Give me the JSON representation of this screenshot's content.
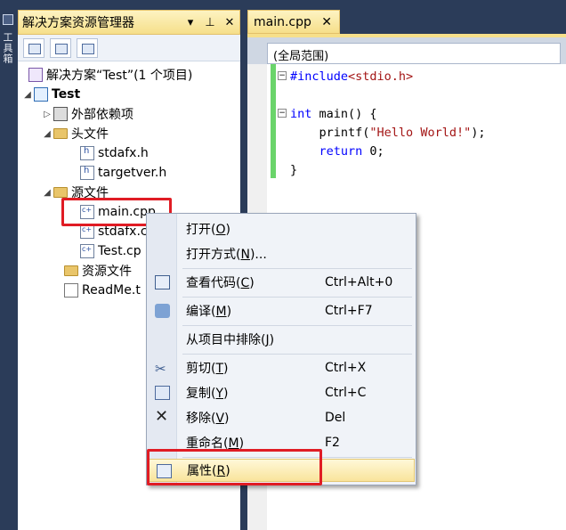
{
  "left_strip": {
    "label": "工具箱"
  },
  "solution_explorer": {
    "title": "解决方案资源管理器",
    "buttons": {
      "dropdown": "▾",
      "pin": "⊥",
      "close": "✕"
    },
    "tree": [
      {
        "text": "解决方案“Test”(1 个项目)",
        "icon": "solution-icon"
      },
      {
        "text": "Test",
        "icon": "project-icon"
      },
      {
        "text": "外部依赖项",
        "icon": "references-icon"
      },
      {
        "text": "头文件",
        "icon": "folder-icon"
      },
      {
        "text": "stdafx.h",
        "icon": "header-file-icon"
      },
      {
        "text": "targetver.h",
        "icon": "header-file-icon"
      },
      {
        "text": "源文件",
        "icon": "folder-icon"
      },
      {
        "text": "main.cpp",
        "icon": "cpp-file-icon"
      },
      {
        "text": "stdafx.c",
        "icon": "cpp-file-icon"
      },
      {
        "text": "Test.cp",
        "icon": "cpp-file-icon"
      },
      {
        "text": "资源文件",
        "icon": "folder-icon"
      },
      {
        "text": "ReadMe.t",
        "icon": "text-file-icon"
      }
    ]
  },
  "editor": {
    "tab_label": "main.cpp",
    "tab_close": "✕",
    "scope_combo": "(全局范围)",
    "code": {
      "include_kw": "#include",
      "include_target": "<stdio.h>",
      "int_kw": "int",
      "main_sig": " main() {",
      "printf_pre": "printf(",
      "printf_str": "\"Hello World!\"",
      "printf_post": ");",
      "return_kw": "return",
      "return_val": " 0;",
      "close_brace": "}"
    }
  },
  "context_menu": {
    "items": [
      {
        "label": "打开",
        "mnemonic": "O",
        "shortcut": ""
      },
      {
        "label": "打开方式",
        "mnemonic": "N",
        "suffix": "...",
        "shortcut": ""
      },
      {
        "label": "查看代码",
        "mnemonic": "C",
        "shortcut": "Ctrl+Alt+0"
      },
      {
        "label": "编译",
        "mnemonic": "M",
        "shortcut": "Ctrl+F7"
      },
      {
        "label": "从项目中排除",
        "mnemonic": "J",
        "shortcut": ""
      },
      {
        "label": "剪切",
        "mnemonic": "T",
        "shortcut": "Ctrl+X"
      },
      {
        "label": "复制",
        "mnemonic": "Y",
        "shortcut": "Ctrl+C"
      },
      {
        "label": "移除",
        "mnemonic": "V",
        "shortcut": "Del"
      },
      {
        "label": "重命名",
        "mnemonic": "M",
        "shortcut": "F2"
      },
      {
        "label": "属性",
        "mnemonic": "R",
        "shortcut": ""
      }
    ]
  },
  "colors": {
    "highlight_box": "#e01c24",
    "tab_gold": "#f6df8a",
    "frame_navy": "#2b3c59"
  }
}
